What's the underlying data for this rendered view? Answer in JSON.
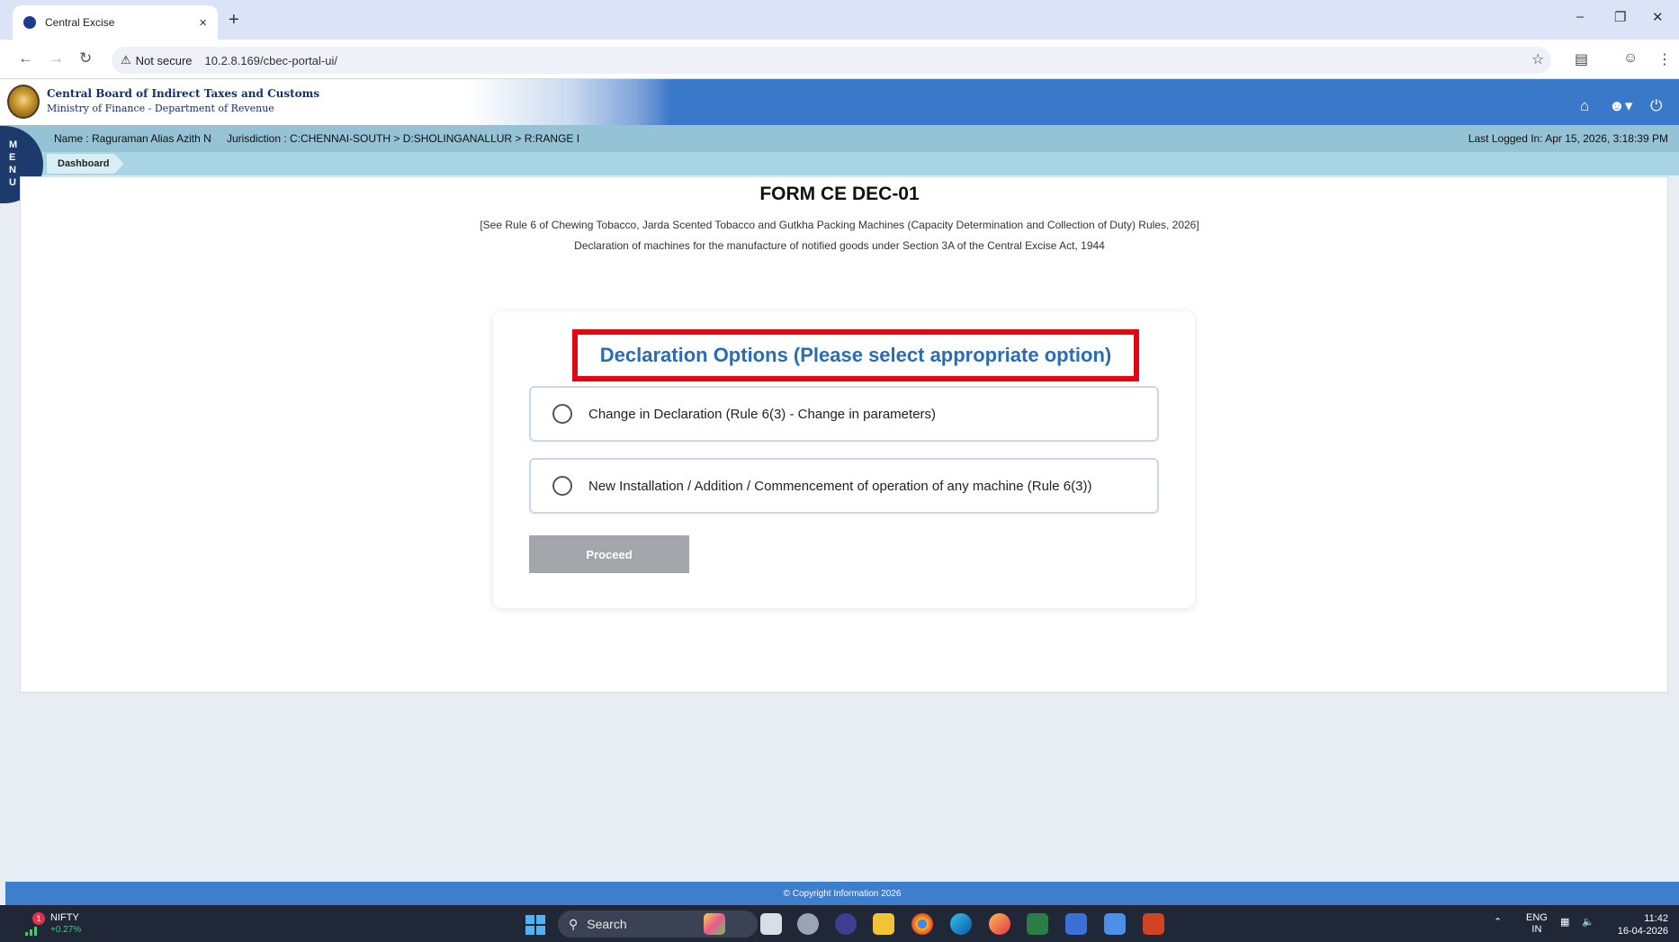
{
  "browser": {
    "tab_title": "Central Excise",
    "tab_close": "×",
    "new_tab": "+",
    "security_label": "Not secure",
    "url": "10.2.8.169/cbec-portal-ui/"
  },
  "header": {
    "org_title": "Central Board of Indirect Taxes and Customs",
    "org_subtitle": "Ministry of Finance - Department of Revenue"
  },
  "user_bar": {
    "name": "Name : Raguraman Alias Azith N",
    "jurisdiction": "Jurisdiction : C:CHENNAI-SOUTH > D:SHOLINGANALLUR > R:RANGE I",
    "last_logged_in": "Last Logged In: Apr 15, 2026, 3:18:39 PM"
  },
  "breadcrumb": {
    "item": "Dashboard"
  },
  "menu_tab": {
    "letters": [
      "M",
      "E",
      "N",
      "U"
    ]
  },
  "form": {
    "title": "FORM CE DEC-01",
    "subtitle_1": "[See Rule 6 of Chewing Tobacco, Jarda Scented Tobacco and Gutkha Packing Machines (Capacity Determination and Collection of Duty) Rules, 2026]",
    "subtitle_2": "Declaration of machines for the manufacture of notified goods under Section 3A of the Central Excise Act, 1944",
    "options_heading": "Declaration Options (Please select appropriate option)",
    "options": [
      {
        "label": "Change in Declaration (Rule 6(3) - Change in parameters)",
        "selected": false
      },
      {
        "label": "New Installation / Addition / Commencement of operation of any machine (Rule 6(3))",
        "selected": false
      }
    ],
    "proceed_label": "Proceed"
  },
  "footer": {
    "copyright": "© Copyright Information 2026"
  },
  "taskbar": {
    "nifty_label": "NIFTY",
    "nifty_change": "+0.27%",
    "nifty_badge": "1",
    "search_label": "Search",
    "lang": "ENG",
    "region": "IN",
    "time": "11:42",
    "date": "16-04-2026"
  },
  "colors": {
    "header_blue": "#3a78c9",
    "info_bar": "#95c3d6",
    "heading_blue": "#2a6db5",
    "highlight_red": "#e30613",
    "proceed_gray": "#a3a6ab"
  }
}
